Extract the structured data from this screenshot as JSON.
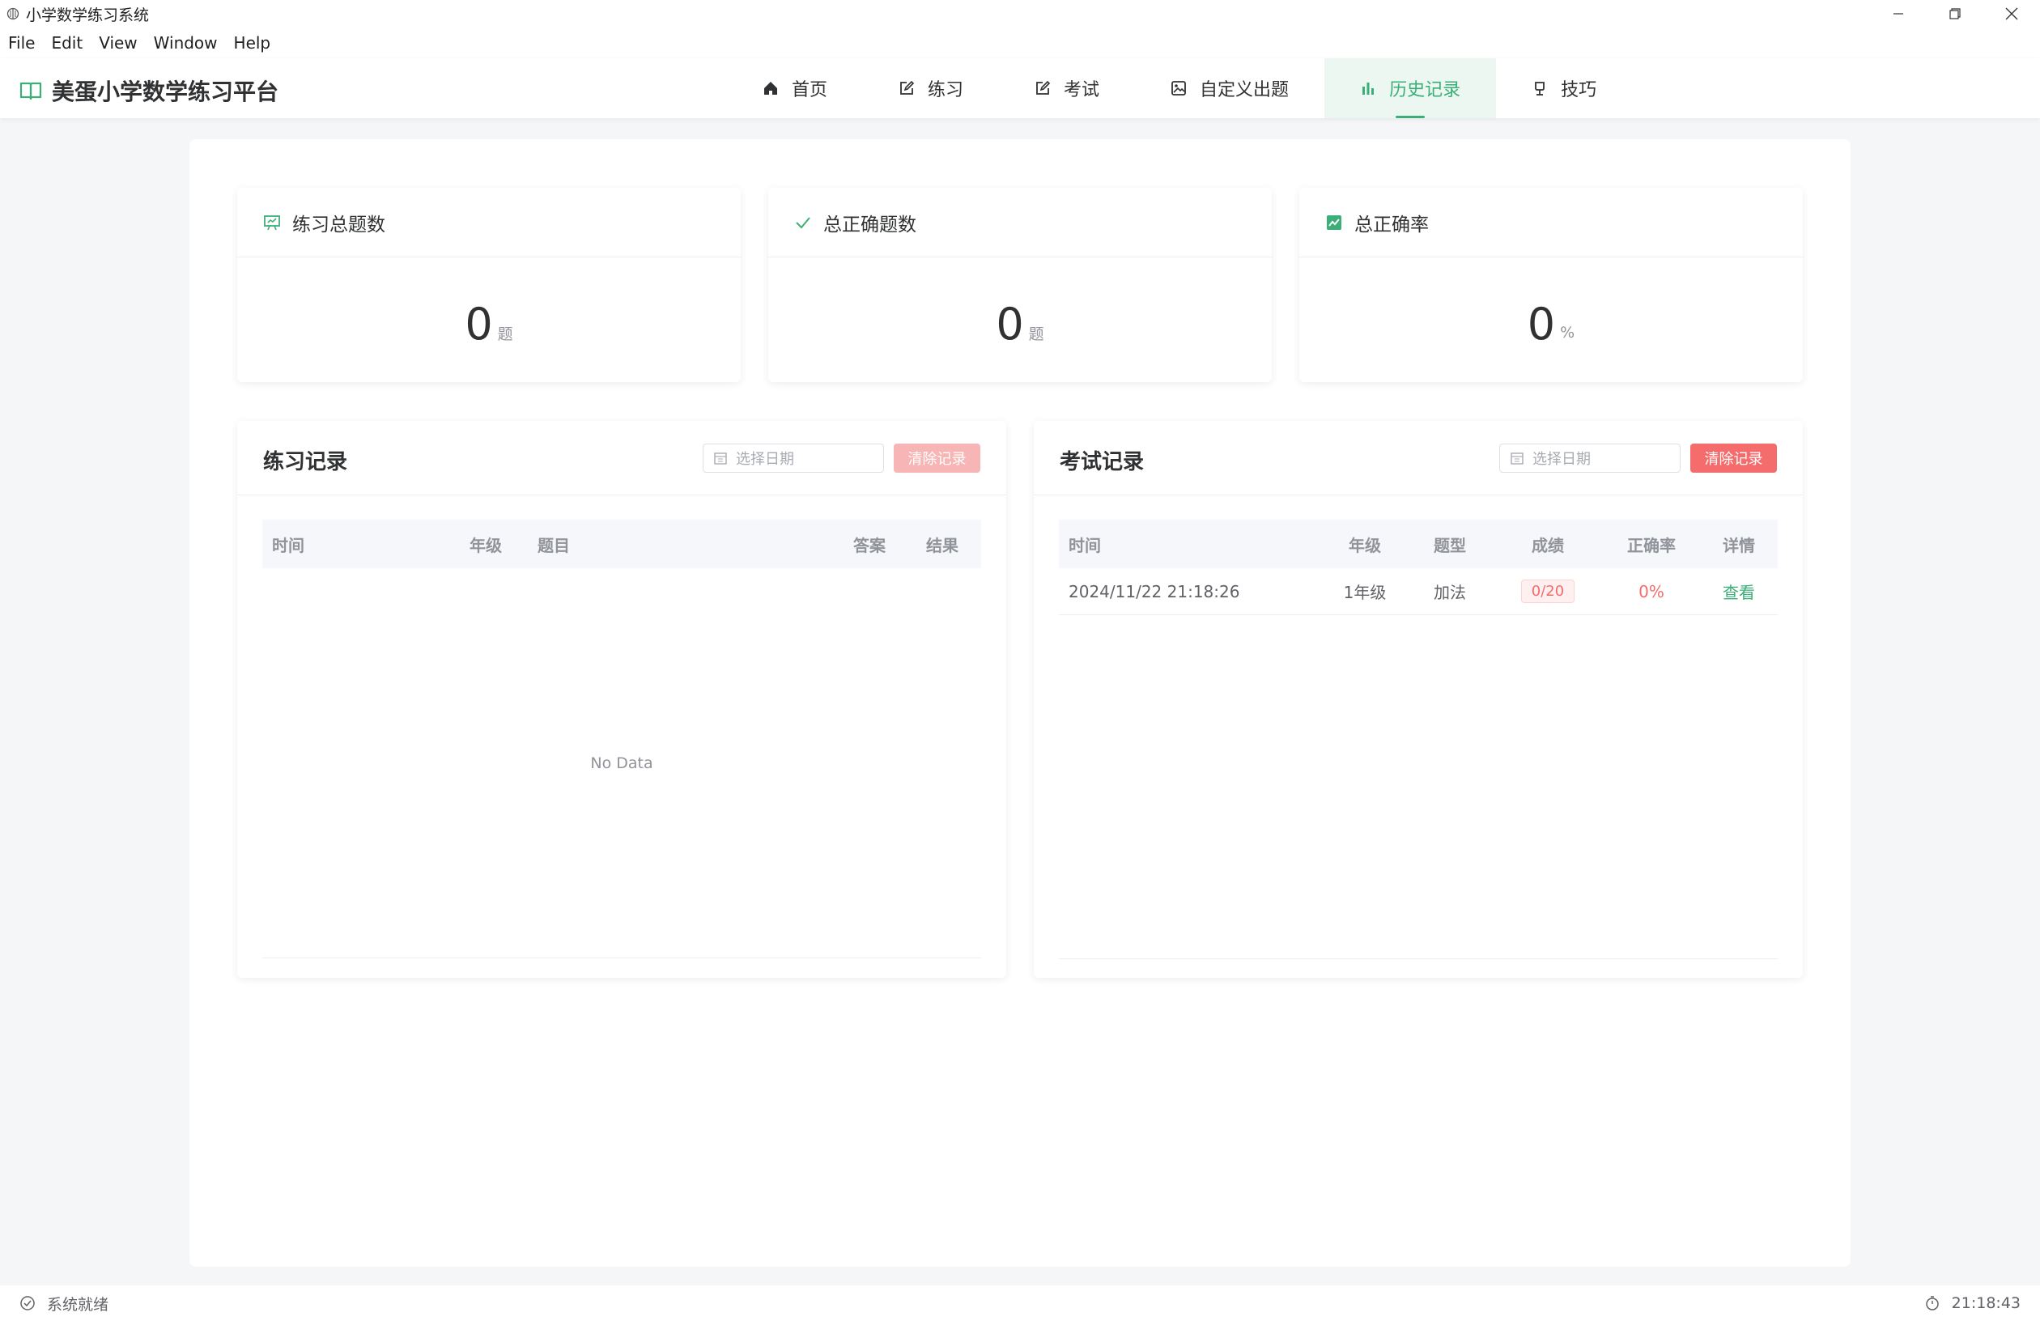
{
  "window": {
    "title": "小学数学练习系统"
  },
  "menubar": {
    "items": [
      "File",
      "Edit",
      "View",
      "Window",
      "Help"
    ]
  },
  "header": {
    "brand_title": "美蛋小学数学练习平台",
    "nav": [
      {
        "label": "首页",
        "icon": "home-icon"
      },
      {
        "label": "练习",
        "icon": "edit-icon"
      },
      {
        "label": "考试",
        "icon": "edit-icon"
      },
      {
        "label": "自定义出题",
        "icon": "picture-icon"
      },
      {
        "label": "历史记录",
        "icon": "histogram-icon",
        "active": true
      },
      {
        "label": "技巧",
        "icon": "lamp-icon"
      }
    ]
  },
  "stats": [
    {
      "label": "练习总题数",
      "value": "0",
      "unit": "题",
      "icon": "presentation-icon"
    },
    {
      "label": "总正确题数",
      "value": "0",
      "unit": "题",
      "icon": "check-icon"
    },
    {
      "label": "总正确率",
      "value": "0",
      "unit": "%",
      "icon": "trend-chart-icon"
    }
  ],
  "practice_records": {
    "title": "练习记录",
    "date_placeholder": "选择日期",
    "clear_label": "清除记录",
    "columns": [
      "时间",
      "年级",
      "题目",
      "答案",
      "结果"
    ],
    "empty_text": "No Data"
  },
  "exam_records": {
    "title": "考试记录",
    "date_placeholder": "选择日期",
    "clear_label": "清除记录",
    "columns": [
      "时间",
      "年级",
      "题型",
      "成绩",
      "正确率",
      "详情"
    ],
    "rows": [
      {
        "time": "2024/11/22 21:18:26",
        "grade": "1年级",
        "type": "加法",
        "score": "0/20",
        "accuracy": "0%",
        "detail": "查看"
      }
    ]
  },
  "statusbar": {
    "status": "系统就绪",
    "clock": "21:18:43"
  },
  "colors": {
    "accent": "#3cae78",
    "danger": "#f56c6c",
    "danger_light": "#f8b5b5"
  }
}
